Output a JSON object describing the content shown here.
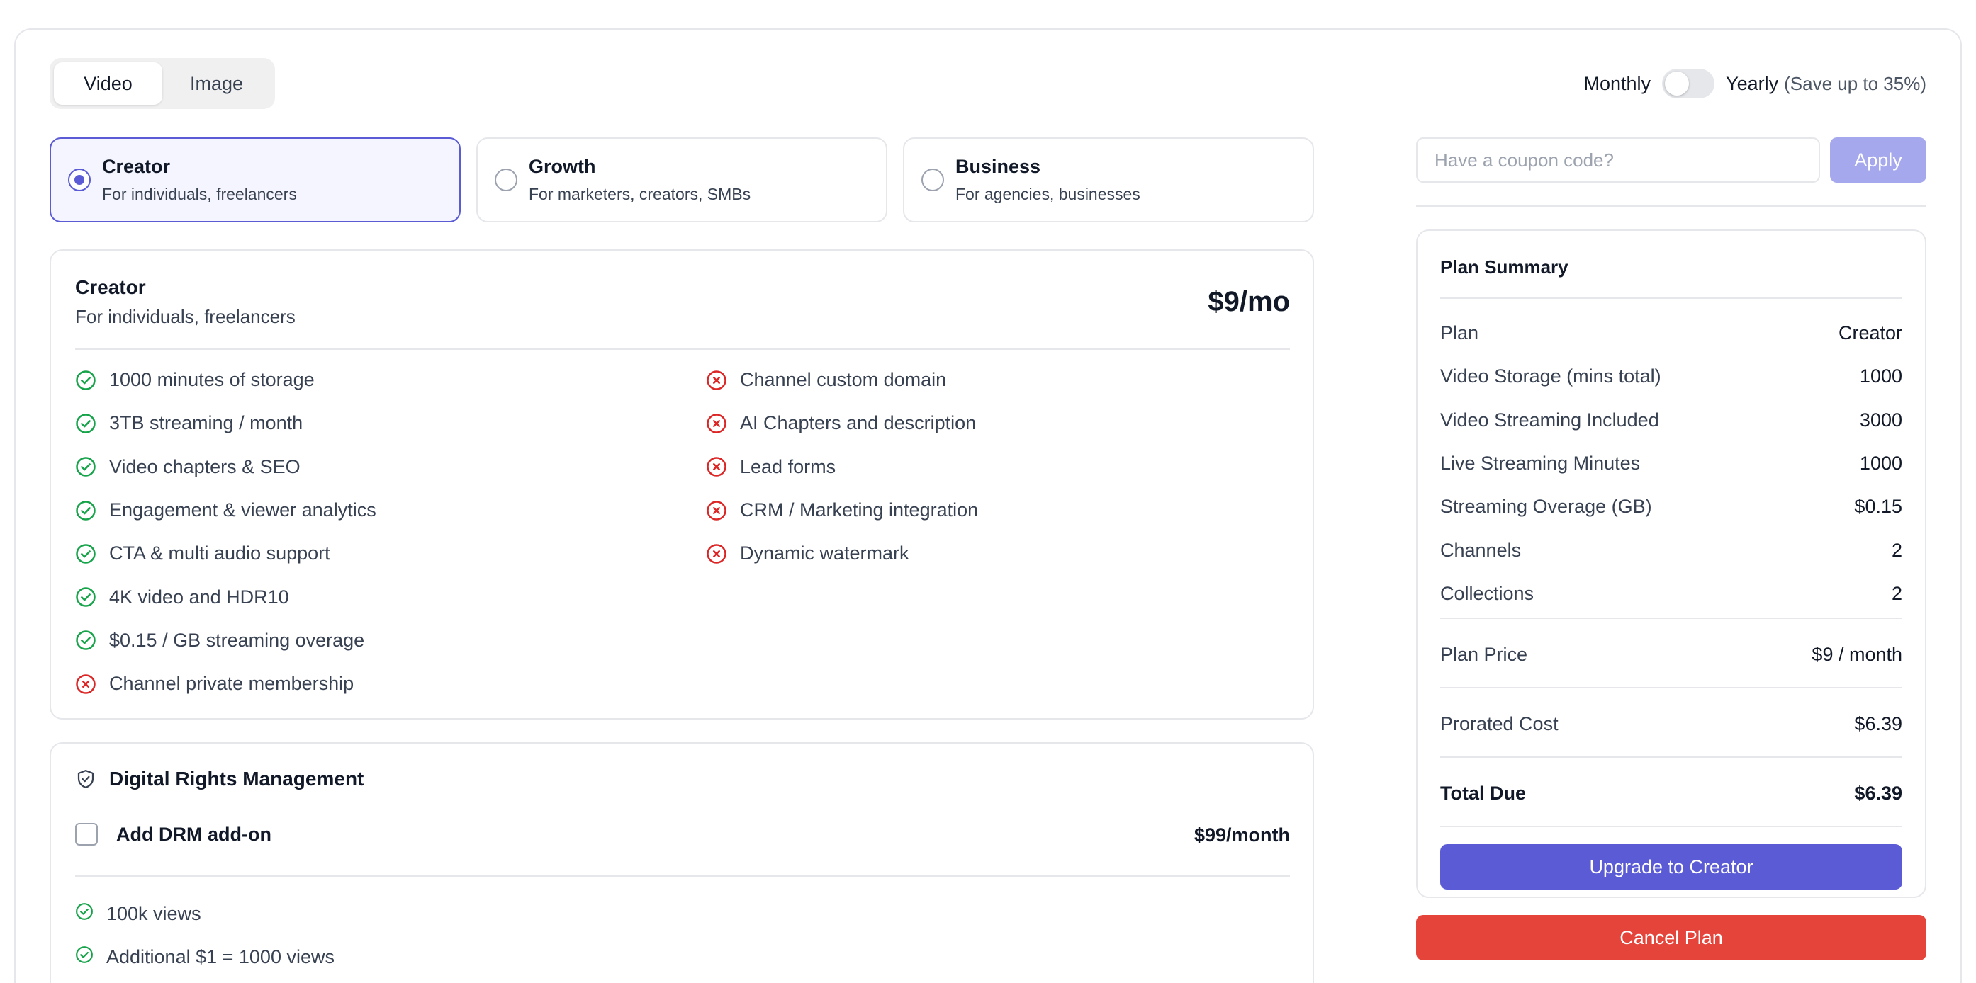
{
  "tabs": [
    {
      "label": "Video",
      "active": true
    },
    {
      "label": "Image",
      "active": false
    }
  ],
  "billing": {
    "monthly_label": "Monthly",
    "yearly_label": "Yearly",
    "save_note": "(Save up to 35%)",
    "yearly_selected": false
  },
  "plans": [
    {
      "name": "Creator",
      "desc": "For individuals, freelancers",
      "selected": true
    },
    {
      "name": "Growth",
      "desc": "For marketers, creators, SMBs",
      "selected": false
    },
    {
      "name": "Business",
      "desc": "For agencies, businesses",
      "selected": false
    }
  ],
  "plan_detail": {
    "title": "Creator",
    "subtitle": "For individuals, freelancers",
    "price": "$9/mo",
    "features_left": [
      {
        "text": "1000 minutes of storage",
        "included": true
      },
      {
        "text": "3TB streaming / month",
        "included": true
      },
      {
        "text": "Video chapters & SEO",
        "included": true
      },
      {
        "text": "Engagement & viewer analytics",
        "included": true
      },
      {
        "text": "CTA & multi audio support",
        "included": true
      },
      {
        "text": "4K video and HDR10",
        "included": true
      },
      {
        "text": "$0.15 / GB streaming overage",
        "included": true
      },
      {
        "text": "Channel private membership",
        "included": false
      }
    ],
    "features_right": [
      {
        "text": "Channel custom domain",
        "included": false
      },
      {
        "text": "AI Chapters and description",
        "included": false
      },
      {
        "text": "Lead forms",
        "included": false
      },
      {
        "text": "CRM / Marketing integration",
        "included": false
      },
      {
        "text": "Dynamic watermark",
        "included": false
      }
    ]
  },
  "drm": {
    "title": "Digital Rights Management",
    "addon_label": "Add DRM add-on",
    "addon_price": "$99/month",
    "items": [
      "100k views",
      "Additional $1 = 1000 views"
    ]
  },
  "coupon": {
    "placeholder": "Have a coupon code?",
    "value": "",
    "apply_label": "Apply"
  },
  "summary": {
    "title": "Plan Summary",
    "rows": [
      {
        "label": "Plan",
        "value": "Creator"
      },
      {
        "label": "Video Storage (mins total)",
        "value": "1000"
      },
      {
        "label": "Video Streaming Included",
        "value": "3000"
      },
      {
        "label": "Live Streaming Minutes",
        "value": "1000"
      },
      {
        "label": "Streaming Overage (GB)",
        "value": "$0.15"
      },
      {
        "label": "Channels",
        "value": "2"
      },
      {
        "label": "Collections",
        "value": "2"
      }
    ],
    "plan_price_label": "Plan Price",
    "plan_price_value": "$9 / month",
    "prorated_label": "Prorated Cost",
    "prorated_value": "$6.39",
    "total_label": "Total Due",
    "total_value": "$6.39",
    "upgrade_label": "Upgrade to Creator"
  },
  "cancel_label": "Cancel Plan",
  "colors": {
    "accent": "#5b5bd6",
    "check_green": "#16a34a",
    "cross_red": "#dc2626",
    "cancel_red": "#e5443b"
  }
}
